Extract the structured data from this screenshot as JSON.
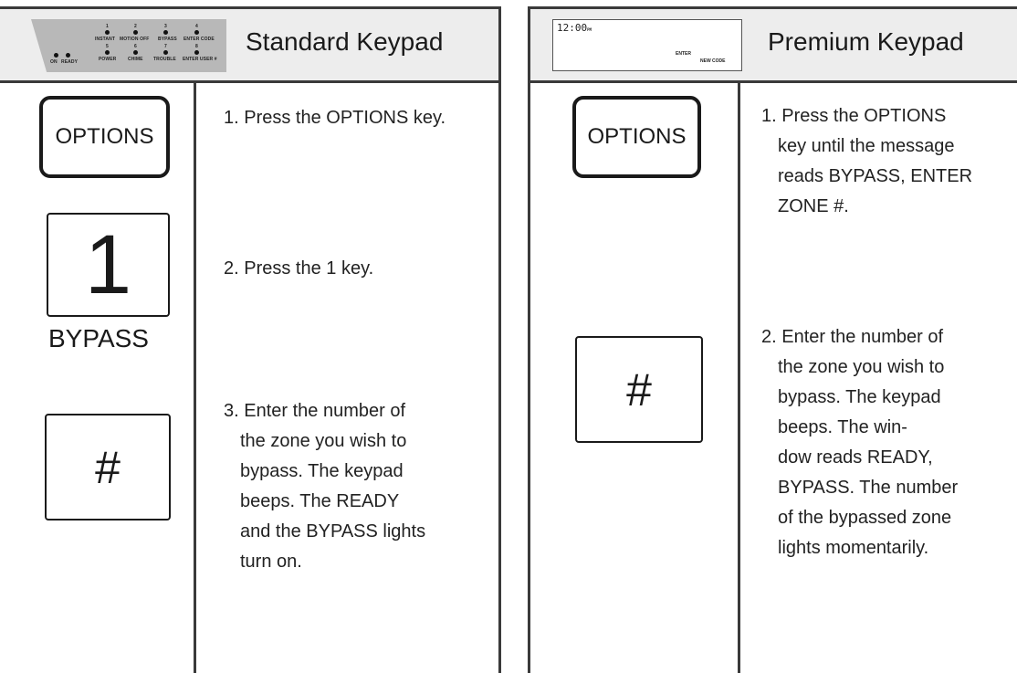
{
  "standard": {
    "title": "Standard Keypad",
    "graphic": {
      "top_numbers": [
        "1",
        "2",
        "3",
        "4"
      ],
      "top_labels": [
        "INSTANT",
        "MOTION OFF",
        "BYPASS",
        "ENTER CODE"
      ],
      "bottom_numbers": [
        "5",
        "6",
        "7",
        "8"
      ],
      "bottom_labels": [
        "POWER",
        "CHIME",
        "TROUBLE",
        "ENTER USER #"
      ],
      "on_label": "ON",
      "ready_label": "READY"
    },
    "keys": {
      "options": "OPTIONS",
      "one": "1",
      "one_caption": "BYPASS",
      "hash": "#"
    },
    "steps": [
      {
        "first": "1. Press the OPTIONS key.",
        "rest": []
      },
      {
        "first": "2. Press the 1 key.",
        "rest": []
      },
      {
        "first": "3. Enter the number of",
        "rest": [
          "the zone you wish to",
          "bypass. The keypad",
          "beeps. The  READY",
          "and the BYPASS lights",
          "turn on."
        ]
      }
    ]
  },
  "premium": {
    "title": "Premium Keypad",
    "lcd": {
      "time": "12:00",
      "pm": "PM",
      "enter": "ENTER",
      "new_code": "NEW CODE"
    },
    "keys": {
      "options": "OPTIONS",
      "hash": "#"
    },
    "steps": [
      {
        "first": "1. Press the OPTIONS",
        "rest": [
          "key until the message",
          "reads BYPASS, ENTER",
          "ZONE #."
        ]
      },
      {
        "first": "2. Enter the number of",
        "rest": [
          "the zone you wish to",
          "bypass. The keypad",
          "beeps. The  win-",
          "dow reads READY,",
          "BYPASS. The number",
          "of the bypassed zone",
          "lights  momentarily."
        ]
      }
    ]
  }
}
